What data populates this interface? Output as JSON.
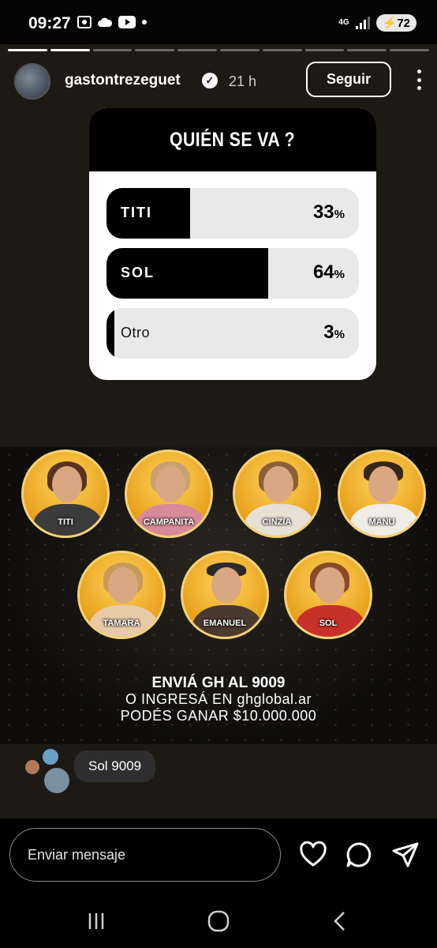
{
  "status_bar": {
    "time": "09:27",
    "network": "4G",
    "battery": "72"
  },
  "story": {
    "username": "gastontrezeguet",
    "verified": true,
    "time_ago": "21 h",
    "follow_label": "Seguir",
    "segments_total": 10,
    "segments_done": 2
  },
  "poll": {
    "question": "QUIÉN SE VA ?",
    "options": [
      {
        "label": "TITI",
        "percent": 33,
        "percent_text": "33",
        "percent_sign": "%"
      },
      {
        "label": "SOL",
        "percent": 64,
        "percent_text": "64",
        "percent_sign": "%"
      },
      {
        "label": "Otro",
        "percent": 3,
        "percent_text": "3",
        "percent_sign": "%"
      }
    ]
  },
  "banner": {
    "contestants": [
      "TITI",
      "CAMPANITA",
      "CINZIA",
      "MANU",
      "TAMARA",
      "EMANUEL",
      "SOL"
    ],
    "cta_line1": "ENVIÁ GH AL 9009",
    "cta_line2": "O INGRESÁ EN ghglobal.ar",
    "cta_line3": "PODÉS GANAR $10.000.000",
    "accent_color": "#e9a822"
  },
  "reply": {
    "text": "Sol 9009"
  },
  "message_bar": {
    "placeholder": "Enviar mensaje",
    "icons": [
      "heart-icon",
      "comment-icon",
      "share-icon"
    ]
  },
  "nav_bar": {
    "icons": [
      "recent-apps-icon",
      "home-icon",
      "back-icon"
    ]
  }
}
